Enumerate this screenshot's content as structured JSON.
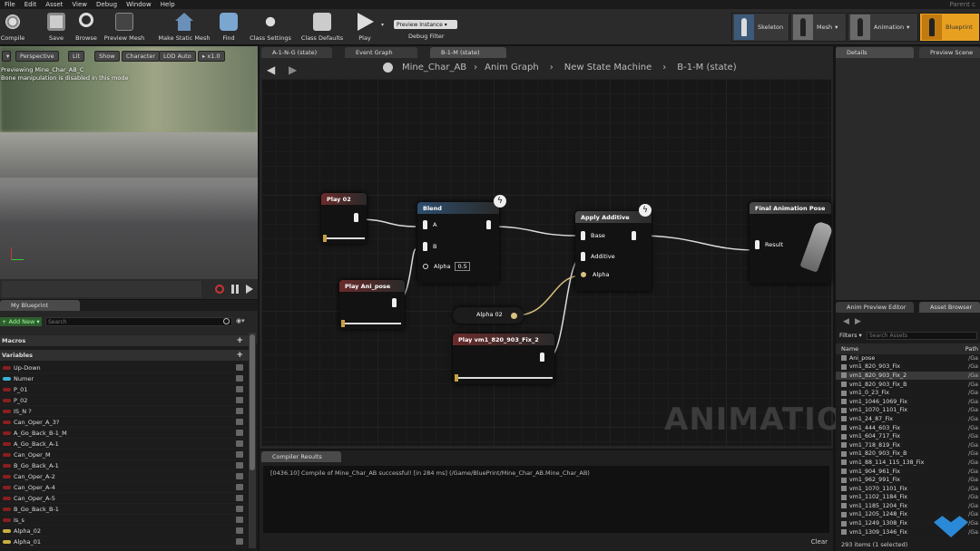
{
  "menu": {
    "items": [
      "File",
      "Edit",
      "Asset",
      "View",
      "Debug",
      "Window",
      "Help"
    ],
    "right": "Parent c"
  },
  "toolbar": {
    "compile": "Compile",
    "save": "Save",
    "browse": "Browse",
    "preview_mesh": "Preview Mesh",
    "make_static_mesh": "Make Static Mesh",
    "find": "Find",
    "class_settings": "Class Settings",
    "class_defaults": "Class Defaults",
    "play": "Play",
    "preview_instance": "Preview Instance ▾",
    "debug_filter": "Debug Filter",
    "modes": [
      "Skeleton",
      "Mesh",
      "Animation",
      "Blueprint"
    ]
  },
  "viewport": {
    "buttons": [
      "Perspective",
      "Lit",
      "Show",
      "Character",
      "LOD Auto",
      "▸ x1.0"
    ],
    "line1": "Previewing Mine_Char_AB_C",
    "line2": "Bone manipulation is disabled in this mode"
  },
  "my_blueprint": {
    "tab": "My Blueprint",
    "add_new": "+ Add New ▾",
    "search_placeholder": "Search",
    "macros": "Macros",
    "variables": "Variables",
    "vars": [
      {
        "name": "Up-Down",
        "color": "#8b1e1e"
      },
      {
        "name": "Numer",
        "color": "#3fb0d8"
      },
      {
        "name": "P_01",
        "color": "#8b1e1e"
      },
      {
        "name": "P_02",
        "color": "#8b1e1e"
      },
      {
        "name": "IS_N ?",
        "color": "#8b1e1e"
      },
      {
        "name": "Can_Oper_A_3?",
        "color": "#8b1e1e"
      },
      {
        "name": "A_Go_Back_B-1_M",
        "color": "#8b1e1e"
      },
      {
        "name": "A_Go_Back_A-1",
        "color": "#8b1e1e"
      },
      {
        "name": "Can_Oper_M",
        "color": "#8b1e1e"
      },
      {
        "name": "B_Go_Back_A-1",
        "color": "#8b1e1e"
      },
      {
        "name": "Can_Oper_A-2",
        "color": "#8b1e1e"
      },
      {
        "name": "Can_Oper_A-4",
        "color": "#8b1e1e"
      },
      {
        "name": "Can_Oper_A-5",
        "color": "#8b1e1e"
      },
      {
        "name": "B_Go_Back_B-1",
        "color": "#8b1e1e"
      },
      {
        "name": "Is_s",
        "color": "#8b1e1e"
      },
      {
        "name": "Alpha_02",
        "color": "#c8b040"
      },
      {
        "name": "Alpha_01",
        "color": "#c8b040"
      }
    ]
  },
  "graph": {
    "tabs": [
      "A-1-N-G (state)",
      "Event Graph",
      "B-1-M (state)"
    ],
    "breadcrumb": [
      "Mine_Char_AB",
      "Anim Graph",
      "New State Machine",
      "B-1-M (state)"
    ],
    "watermark": "ANIMATION",
    "nodes": {
      "play02": "Play 02",
      "blend": "Blend",
      "blend_a": "A",
      "blend_b": "B",
      "alpha": "Alpha",
      "alpha_val": "0.5",
      "apply_additive": "Apply Additive",
      "base": "Base",
      "additive": "Additive",
      "alpha2": "Alpha",
      "final_pose": "Final Animation Pose",
      "result": "Result",
      "play_ani_pose": "Play Ani_pose",
      "alpha02": "Alpha 02",
      "play_vm1": "Play vm1_820_903_Fix_2"
    }
  },
  "compiler": {
    "tab": "Compiler Results",
    "message": "[0436.10] Compile of Mine_Char_AB successful! [in 284 ms] (/Game/BluePrint/Mine_Char_AB.Mine_Char_AB)",
    "clear": "Clear"
  },
  "details": {
    "tab": "Details",
    "tab2": "Preview Scene"
  },
  "assets": {
    "tab": "Anim Preview Editor",
    "tab2": "Asset Browser",
    "filters": "Filters ▾",
    "search_placeholder": "Search Assets",
    "col_name": "Name",
    "col_path": "Path",
    "items": [
      "Ani_pose",
      "vm1_820_903_Fix",
      "vm1_820_903_Fix_2",
      "vm1_820_903_Fix_B",
      "vm1_0_23_Fix",
      "vm1_1046_1069_Fix",
      "vm1_1070_1101_Fix",
      "vm1_24_87_Fix",
      "vm1_444_603_Fix",
      "vm1_604_717_Fix",
      "vm1_718_819_Fix",
      "vm1_820_903_Fix_B",
      "vm1_88_114_115_138_Fix",
      "vm1_904_961_Fix",
      "vm1_962_991_Fix",
      "vm1_1070_1101_Fix",
      "vm1_1102_1184_Fix",
      "vm1_1185_1204_Fix",
      "vm1_1205_1248_Fix",
      "vm1_1249_1308_Fix",
      "vm1_1309_1346_Fix"
    ],
    "path": "/Ga",
    "selected_index": 2,
    "count": "293 items (1 selected)"
  }
}
